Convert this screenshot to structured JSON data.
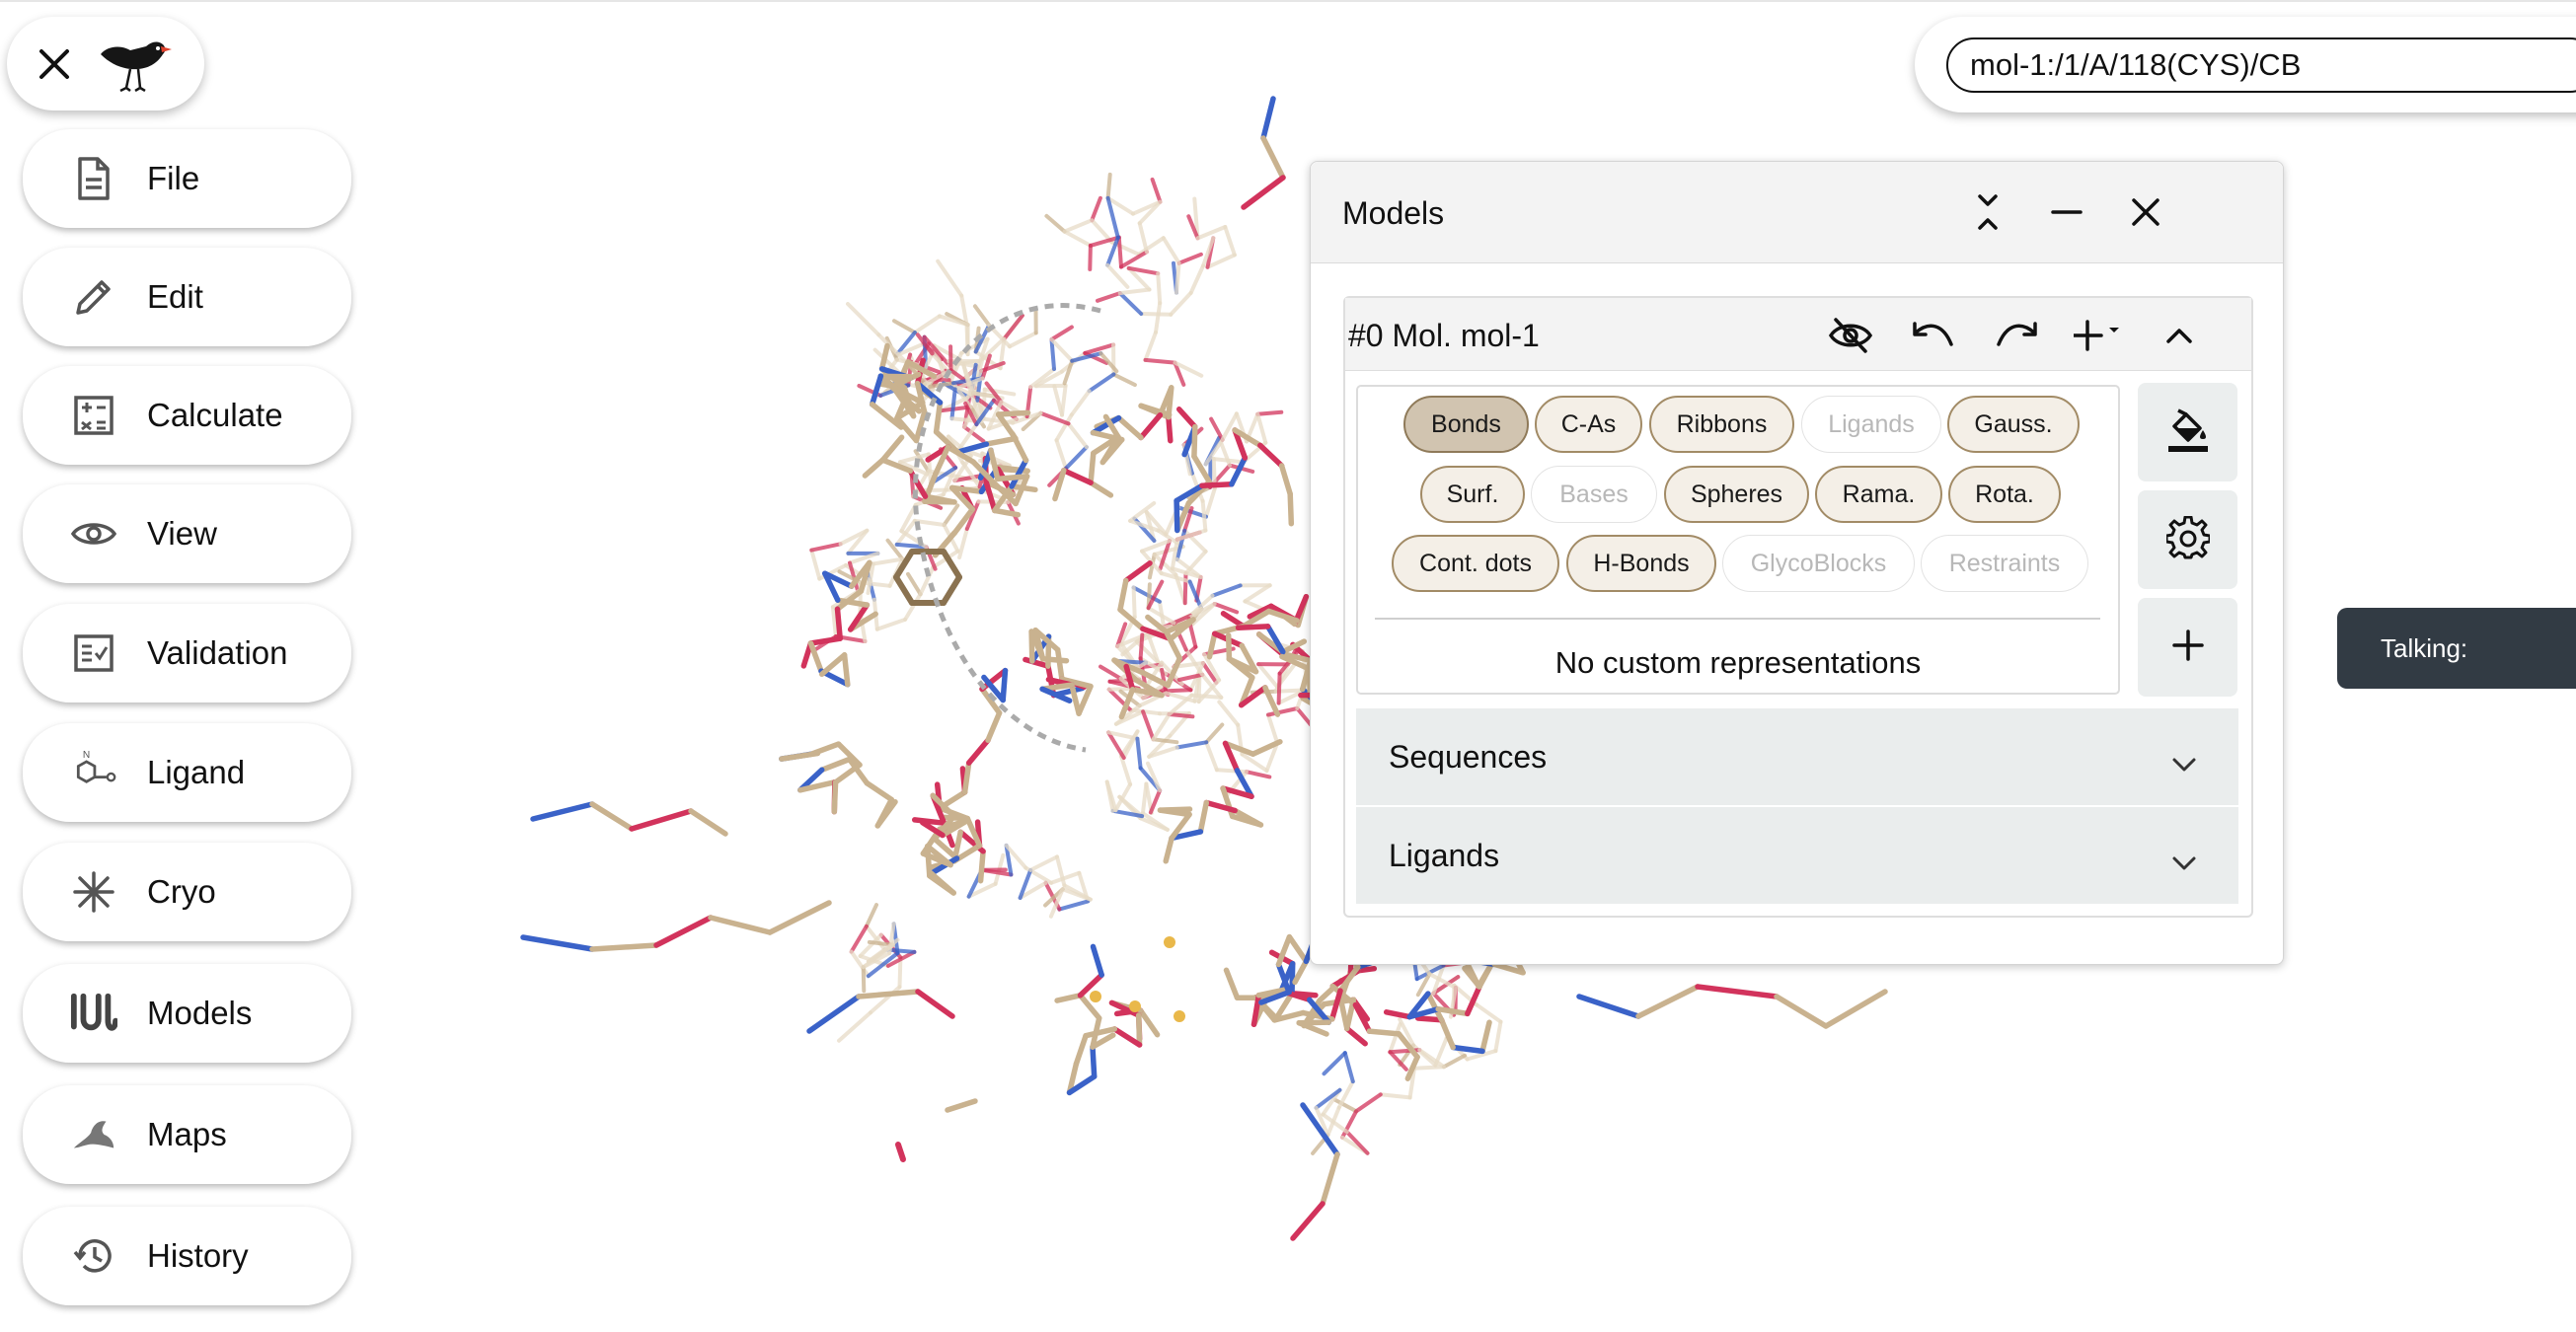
{
  "app": {
    "logo": "bird-logo",
    "close_icon": "close-icon"
  },
  "menu": [
    {
      "id": "file",
      "label": "File",
      "icon": "file-icon"
    },
    {
      "id": "edit",
      "label": "Edit",
      "icon": "pencil-icon"
    },
    {
      "id": "calculate",
      "label": "Calculate",
      "icon": "calculator-icon"
    },
    {
      "id": "view",
      "label": "View",
      "icon": "eye-icon"
    },
    {
      "id": "validation",
      "label": "Validation",
      "icon": "checklist-icon"
    },
    {
      "id": "ligand",
      "label": "Ligand",
      "icon": "ligand-icon"
    },
    {
      "id": "cryo",
      "label": "Cryo",
      "icon": "snowflake-icon"
    },
    {
      "id": "models",
      "label": "Models",
      "icon": "models-icon"
    },
    {
      "id": "maps",
      "label": "Maps",
      "icon": "maps-icon"
    },
    {
      "id": "history",
      "label": "History",
      "icon": "history-icon"
    }
  ],
  "search": {
    "value": "mol-1:/1/A/118(CYS)/CB"
  },
  "talking": {
    "label": "Talking:"
  },
  "models_window": {
    "title": "Models",
    "molecule": {
      "name": "#0 Mol. mol-1",
      "representations": [
        {
          "label": "Bonds",
          "state": "selected"
        },
        {
          "label": "C-As",
          "state": "enabled"
        },
        {
          "label": "Ribbons",
          "state": "enabled"
        },
        {
          "label": "Ligands",
          "state": "disabled"
        },
        {
          "label": "Gauss.",
          "state": "enabled"
        },
        {
          "label": "Surf.",
          "state": "enabled"
        },
        {
          "label": "Bases",
          "state": "disabled"
        },
        {
          "label": "Spheres",
          "state": "enabled"
        },
        {
          "label": "Rama.",
          "state": "enabled"
        },
        {
          "label": "Rota.",
          "state": "enabled"
        },
        {
          "label": "Cont. dots",
          "state": "enabled"
        },
        {
          "label": "H-Bonds",
          "state": "enabled"
        },
        {
          "label": "GlycoBlocks",
          "state": "disabled"
        },
        {
          "label": "Restraints",
          "state": "disabled"
        }
      ],
      "custom_reps_text": "No custom representations",
      "sections": [
        {
          "label": "Sequences"
        },
        {
          "label": "Ligands"
        }
      ]
    }
  },
  "colors": {
    "carbon": "#c9b28f",
    "carbon_faded": "#e8dcc7",
    "nitrogen": "#3a62c8",
    "oxygen": "#d2335c",
    "sulfur": "#e9b84a",
    "toast_bg": "#323b44",
    "chip_selected": "#d1c4b0",
    "chip_enabled": "#f4efe7"
  }
}
